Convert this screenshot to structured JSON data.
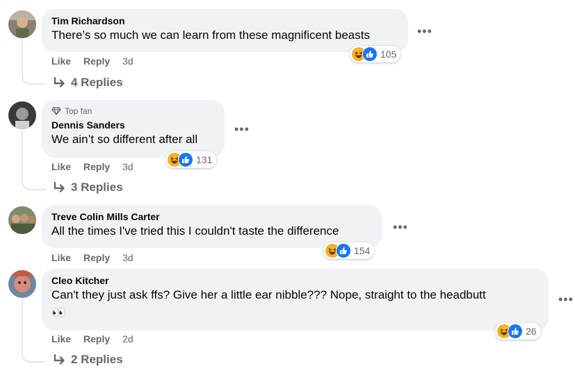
{
  "actions": {
    "like": "Like",
    "reply": "Reply"
  },
  "comments": [
    {
      "author": "Tim Richardson",
      "text": "There’s so much we can learn from these magnificent beasts",
      "time": "3d",
      "reaction_count": "105",
      "replies": "4 Replies"
    },
    {
      "badge": "Top fan",
      "author": "Dennis Sanders",
      "text": "We ain’t so different after all",
      "time": "3d",
      "reaction_count": "131",
      "replies": "3 Replies"
    },
    {
      "author": "Treve Colin Mills Carter",
      "text": "All the times I've tried this I couldn't taste the difference",
      "time": "3d",
      "reaction_count": "154"
    },
    {
      "author": "Cleo Kitcher",
      "text": "Can't they just ask ffs? Give her a little ear nibble??? Nope, straight to the headbutt",
      "text_line2": "👀",
      "time": "2d",
      "reaction_count": "26",
      "replies": "2 Replies"
    }
  ],
  "icons": {
    "haha": "haha-reaction-icon",
    "like": "like-reaction-icon",
    "more": "more-options-icon",
    "reply_arrow": "reply-arrow-icon",
    "top_fan": "diamond-icon"
  },
  "colors": {
    "bubble": "#f0f2f5",
    "muted_text": "#65676b",
    "like_blue": "#1877f2",
    "haha_yellow": "#f7b125"
  }
}
